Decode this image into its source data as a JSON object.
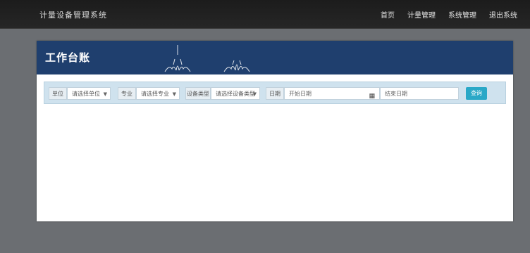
{
  "topbar": {
    "brand": "计量设备管理系统",
    "nav": [
      "首页",
      "计量管理",
      "系统管理",
      "退出系统"
    ]
  },
  "panel": {
    "title": "工作台账"
  },
  "filters": {
    "f1_label": "单位",
    "f1_value": "请选择单位",
    "f2_label": "专业",
    "f2_value": "请选择专业",
    "f3_label": "设备类型",
    "f3_value": "请选择设备类型",
    "f4_label": "日期",
    "date_start": "开始日期",
    "date_end": "结束日期",
    "search_label": "查询"
  },
  "icons": {
    "select_caret": "chevron-down-icon",
    "calendar": "calendar-icon"
  },
  "colors": {
    "topbar": "#1f1f1f",
    "header": "#1f3f6e",
    "filterbar": "#cfe2ee",
    "button": "#2aa8c7"
  }
}
